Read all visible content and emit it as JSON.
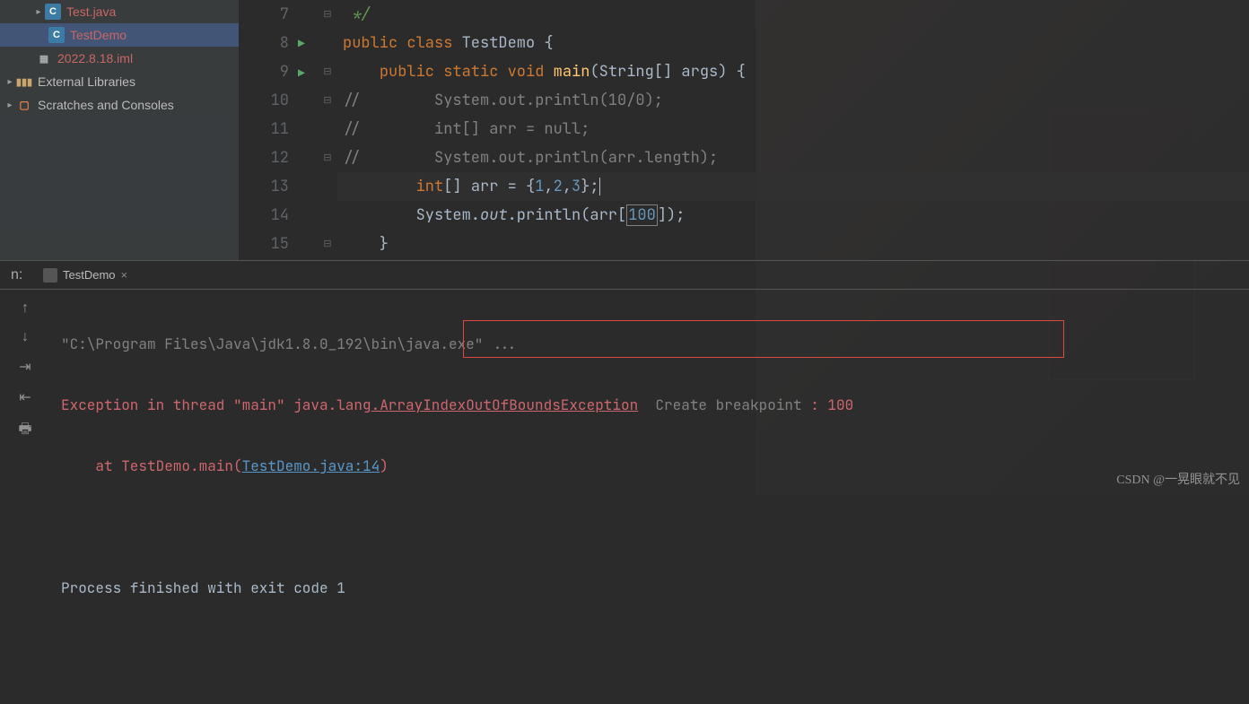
{
  "tree": {
    "file_java": "Test.java",
    "file_demo": "TestDemo",
    "file_iml": "2022.8.18.iml",
    "ext_libs": "External Libraries",
    "scratches": "Scratches and Consoles"
  },
  "editor": {
    "lines": [
      {
        "n": "7",
        "run": "",
        "fold": "⊟",
        "html": "<span class='doc'> */</span>"
      },
      {
        "n": "8",
        "run": "▶",
        "fold": "",
        "html": "<span class='kw'>public class</span> <span class='id'>TestDemo</span> {"
      },
      {
        "n": "9",
        "run": "▶",
        "fold": "⊟",
        "html": "    <span class='kw'>public static void</span> <span class='fn'>main</span>(String[] args) {"
      },
      {
        "n": "10",
        "run": "",
        "fold": "⊟",
        "html": "<span class='cm'>//        System.out.println(10/0);</span>"
      },
      {
        "n": "11",
        "run": "",
        "fold": "",
        "html": "<span class='cm'>//        int[] arr = null;</span>"
      },
      {
        "n": "12",
        "run": "",
        "fold": "⊟",
        "html": "<span class='cm'>//        System.out.println(arr.length);</span>"
      },
      {
        "n": "13",
        "run": "",
        "fold": "",
        "hl": true,
        "html": "        <span class='kw'>int</span>[] arr = {<span class='num'>1</span>,<span class='num'>2</span>,<span class='num'>3</span>};<span class='caret-bar'></span>"
      },
      {
        "n": "14",
        "run": "",
        "fold": "",
        "html": "        System.<span class='it'>out</span>.println(arr[<span class='num box-num'>100</span>]);"
      },
      {
        "n": "15",
        "run": "",
        "fold": "⊟",
        "html": "    }"
      }
    ]
  },
  "console": {
    "tab": {
      "label": "TestDemo"
    },
    "out": {
      "line1_pre": "\"C:\\Program Files\\Java\\jdk1.8.0_192\\bin\\java.exe\" ",
      "line1_dots": "...",
      "line2_pre": "Exception in thread \"main\" java.lang",
      "line2_ex": ".ArrayIndexOutOfBoundsException",
      "line2_cb": "  Create breakpoint ",
      "line2_tail": ": 100",
      "line3_pre": "    at TestDemo.main(",
      "line3_link": "TestDemo.java:14",
      "line3_post": ")",
      "line4": "Process finished with exit code 1"
    },
    "tools": {
      "up": "↑",
      "down": "↓",
      "wrap": "⇥",
      "stop": "⇤",
      "print": "🖶"
    }
  },
  "watermark": "CSDN @一晃眼就不见"
}
